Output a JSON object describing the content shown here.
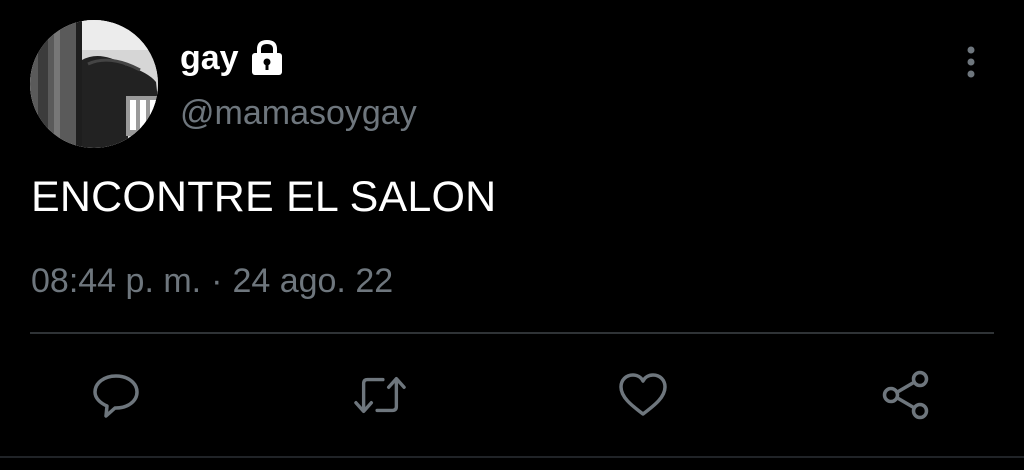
{
  "tweet": {
    "display_name": "gay",
    "handle": "@mamasoygay",
    "text": "ENCONTRE EL SALON",
    "time": "08:44 p. m.",
    "separator": "·",
    "date": "24 ago. 22"
  },
  "icons": {
    "account": "lock-icon",
    "menu": "more-vertical-icon",
    "actions": [
      "reply-icon",
      "retweet-icon",
      "like-icon",
      "share-icon"
    ]
  },
  "colors": {
    "background": "#000000",
    "primary_text": "#ffffff",
    "secondary_text": "#6e767d",
    "divider": "#2f3336"
  }
}
